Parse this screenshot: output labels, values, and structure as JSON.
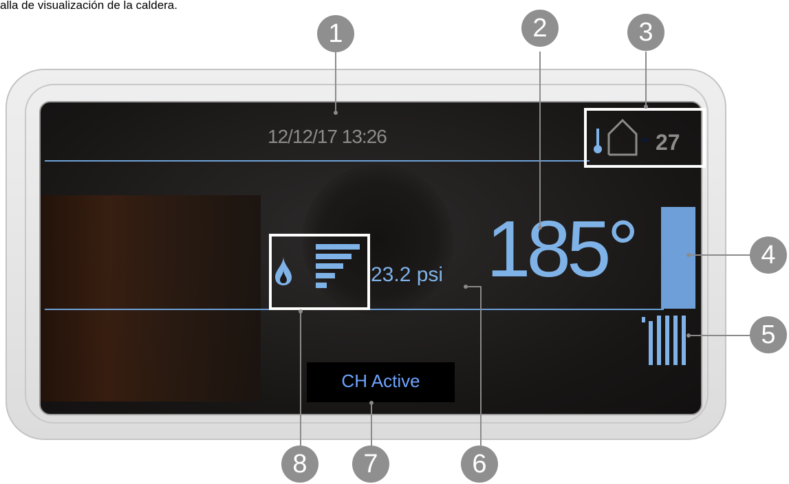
{
  "caption": "alla de visualización de la caldera.",
  "display": {
    "datetime": "12/12/17 13:26",
    "outdoor_temp": "27",
    "outdoor_sign": "-",
    "boiler_temp": "185°",
    "pressure": "23.2 psi",
    "status": "CH Active",
    "flame_level": 5
  },
  "callouts": [
    "1",
    "2",
    "3",
    "4",
    "5",
    "6",
    "7",
    "8"
  ],
  "colors": {
    "lcd": "#7fb3e8",
    "badge": "#8f8f8f",
    "frame": "#ffffff"
  },
  "icons": [
    "thermometer-icon",
    "house-icon",
    "flame-icon",
    "flame-level-bars-icon",
    "temperature-bar-icon",
    "radiator-icon"
  ]
}
